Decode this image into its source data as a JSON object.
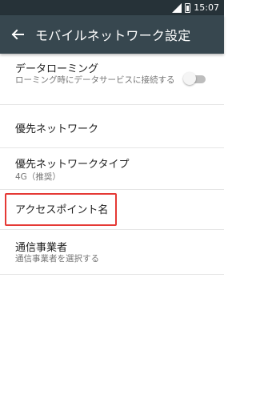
{
  "status_bar": {
    "time": "15:07",
    "signal_icon": "signal-icon",
    "battery_icon": "battery-icon"
  },
  "app_bar": {
    "back_icon": "arrow-back-icon",
    "title": "モバイルネットワーク設定"
  },
  "settings": {
    "data_roaming": {
      "title": "データローミング",
      "summary": "ローミング時にデータサービスに接続する",
      "toggle_on": false
    },
    "preferred_network": {
      "title": "優先ネットワーク"
    },
    "preferred_network_type": {
      "title": "優先ネットワークタイプ",
      "summary": "4G（推奨）"
    },
    "access_point_names": {
      "title": "アクセスポイント名",
      "highlight_color": "#e53935"
    },
    "carrier": {
      "title": "通信事業者",
      "summary": "通信事業者を選択する"
    }
  },
  "colors": {
    "status_bar": "#263238",
    "app_bar": "#37474f"
  }
}
